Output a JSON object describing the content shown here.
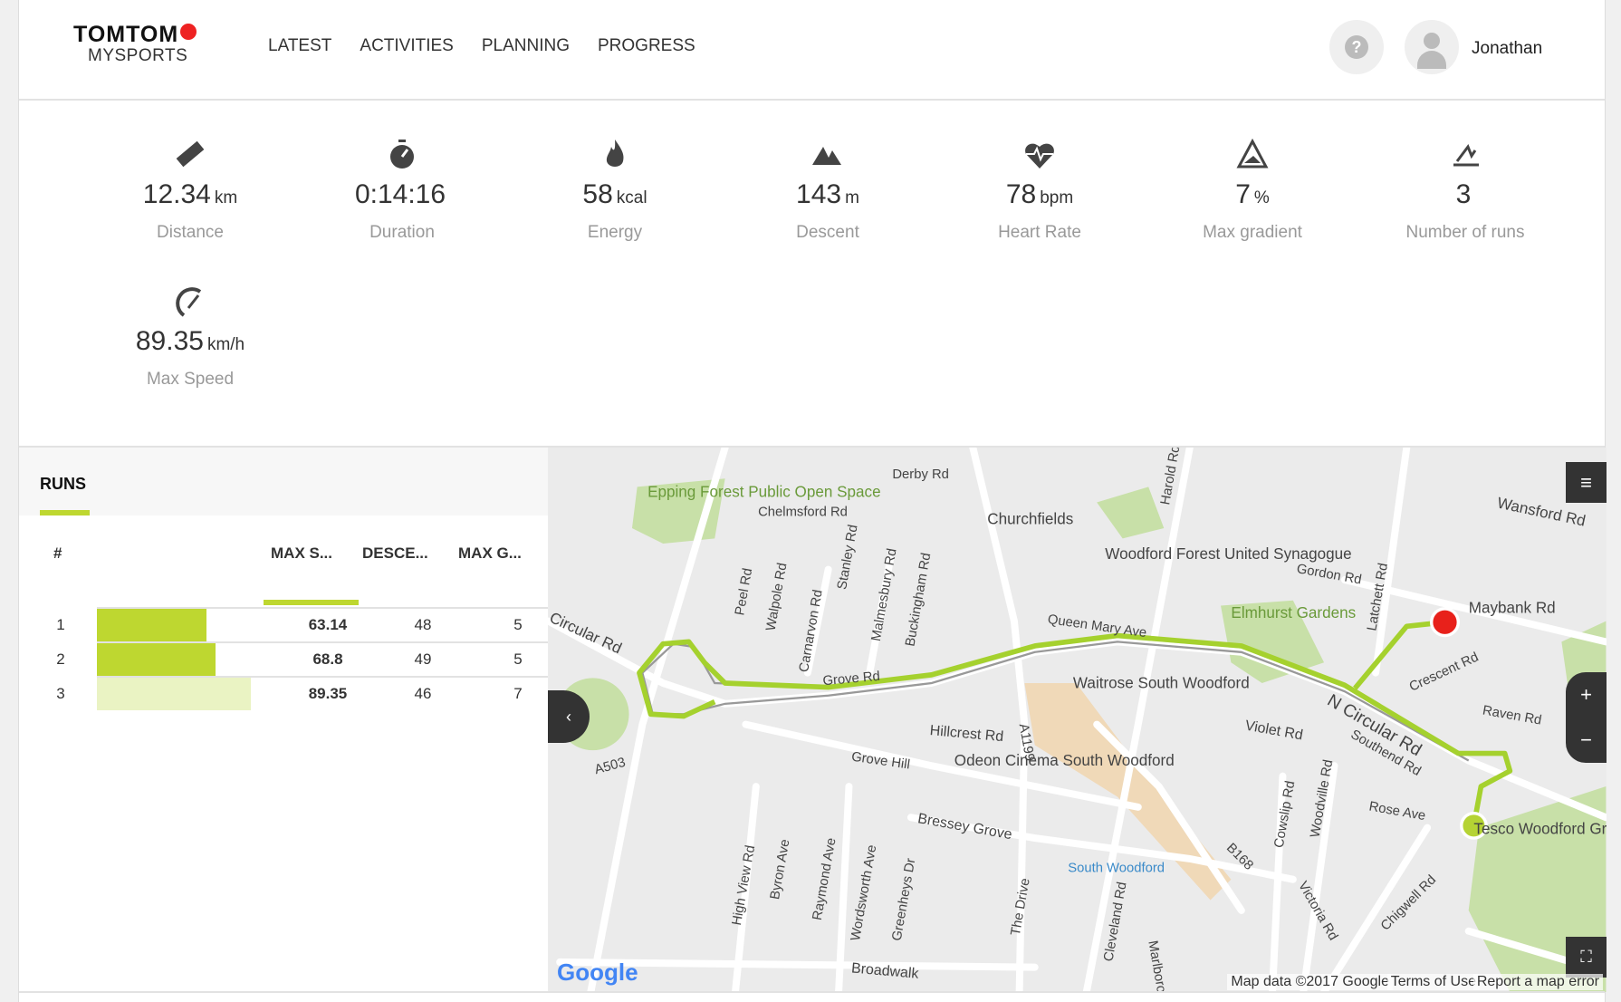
{
  "header": {
    "logo_top": "TOMTOM",
    "logo_bottom": "MYSPORTS",
    "nav": [
      "LATEST",
      "ACTIVITIES",
      "PLANNING",
      "PROGRESS"
    ],
    "help_icon": "?",
    "user_name": "Jonathan"
  },
  "stats": [
    {
      "icon": "ruler-icon",
      "value": "12.34",
      "unit": "km",
      "label": "Distance"
    },
    {
      "icon": "stopwatch-icon",
      "value": "0:14:16",
      "unit": "",
      "label": "Duration"
    },
    {
      "icon": "flame-icon",
      "value": "58",
      "unit": "kcal",
      "label": "Energy"
    },
    {
      "icon": "descent-icon",
      "value": "143",
      "unit": "m",
      "label": "Descent"
    },
    {
      "icon": "heart-rate-icon",
      "value": "78",
      "unit": "bpm",
      "label": "Heart Rate"
    },
    {
      "icon": "gradient-icon",
      "value": "7",
      "unit": "%",
      "label": "Max gradient"
    },
    {
      "icon": "runs-icon",
      "value": "3",
      "unit": "",
      "label": "Number of runs"
    },
    {
      "icon": "speedometer-icon",
      "value": "89.35",
      "unit": "km/h",
      "label": "Max Speed"
    }
  ],
  "runs": {
    "title": "RUNS",
    "columns": [
      "#",
      "MAX S...",
      "DESCE...",
      "MAX G..."
    ],
    "rows": [
      {
        "n": "1",
        "max_speed": "63.14",
        "descent": "48",
        "max_gradient": "5",
        "bar_fraction": 0.71
      },
      {
        "n": "2",
        "max_speed": "68.8",
        "descent": "49",
        "max_gradient": "5",
        "bar_fraction": 0.77
      },
      {
        "n": "3",
        "max_speed": "89.35",
        "descent": "46",
        "max_gradient": "7",
        "bar_fraction": 1.0
      }
    ],
    "accent": "#bed730",
    "accent_light": "#eaf3c3"
  },
  "map": {
    "labels": [
      "Epping Forest Public Open Space",
      "Chelmsford Rd",
      "Derby Rd",
      "Churchfields",
      "Woodford Forest United Synagogue",
      "Harold Rd",
      "Gordon Rd",
      "Maybank Rd",
      "Wansford Rd",
      "Elmhurst Gardens",
      "Queen Mary Ave",
      "Crescent Rd",
      "Raven Rd",
      "Grove Rd",
      "Waitrose South Woodford",
      "Hillcrest Rd",
      "Odeon Cinema South Woodford",
      "Violet Rd",
      "N Circular Rd",
      "Southend Rd",
      "Circular Rd",
      "A503",
      "Grove Hill",
      "Bressey Grove",
      "Rose Ave",
      "Tesco Woodford Green Superstore",
      "South Woodford",
      "B168",
      "Peel Rd",
      "Walpole Rd",
      "Carnarvon Rd",
      "Stanley Rd",
      "Malmesbury Rd",
      "Buckingham Rd",
      "High View Rd",
      "Byron Ave",
      "Raymond Ave",
      "Wordsworth Ave",
      "Greenheys Dr",
      "The Drive",
      "Cleveland Rd",
      "Marlborough",
      "Cowslip Rd",
      "Woodville Rd",
      "Victoria Rd",
      "Chigwell Rd",
      "Broadwalk",
      "A1199",
      "Latchett Rd"
    ],
    "google": "Google",
    "map_data": "Map data ©2017 Google",
    "terms": "Terms of Use",
    "report": "Report a map error",
    "route_color": "#a5d12e",
    "start_color": "#b5d334",
    "end_color": "#e8211b"
  }
}
